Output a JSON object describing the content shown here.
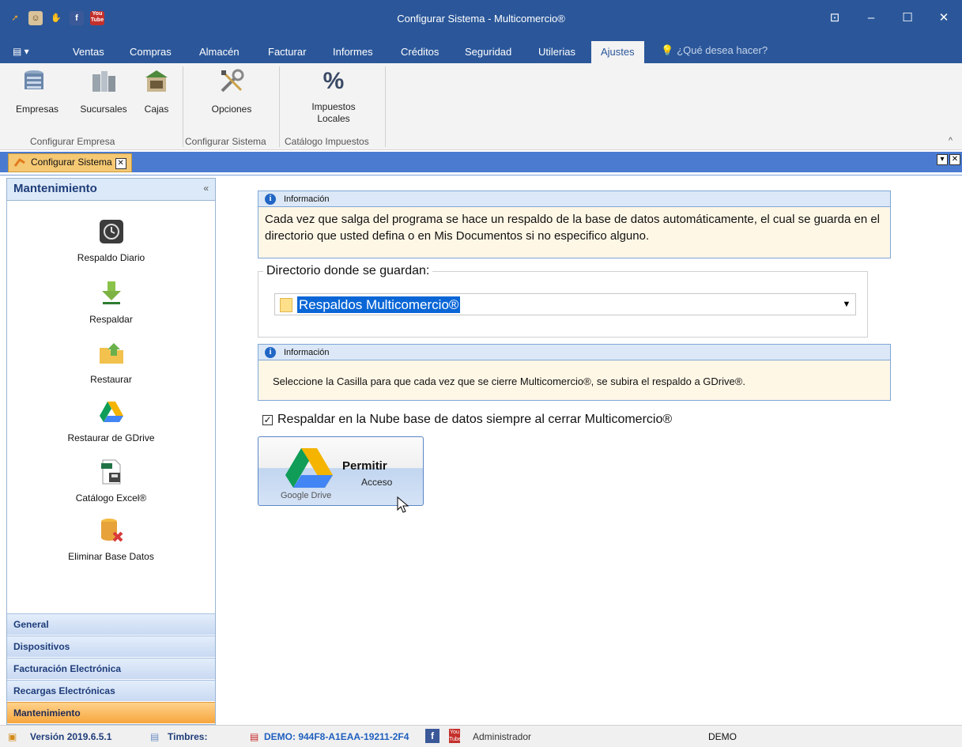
{
  "window": {
    "title": "Configurar Sistema - Multicomercio®",
    "qat_icons": [
      "app-logo-icon",
      "users-icon",
      "hand-icon",
      "facebook-icon",
      "youtube-icon"
    ],
    "youtube_label": "You Tube",
    "facebook_label": "f"
  },
  "menu": {
    "file_icon": "menu-icon",
    "tabs": [
      {
        "label": "Ventas",
        "active": false
      },
      {
        "label": "Compras",
        "active": false
      },
      {
        "label": "Almacén",
        "active": false
      },
      {
        "label": "Facturar",
        "active": false
      },
      {
        "label": "Informes",
        "active": false
      },
      {
        "label": "Créditos",
        "active": false
      },
      {
        "label": "Seguridad",
        "active": false
      },
      {
        "label": "Utilerias",
        "active": false
      },
      {
        "label": "Ajustes",
        "active": true
      }
    ],
    "tellme": "¿Qué desea hacer?"
  },
  "ribbon": {
    "buttons": [
      {
        "label": "Empresas",
        "icon": "building-icon"
      },
      {
        "label": "Sucursales",
        "icon": "branches-icon"
      },
      {
        "label": "Cajas",
        "icon": "store-icon"
      },
      {
        "label": "Opciones",
        "icon": "tools-icon"
      },
      {
        "label": "Impuestos Locales",
        "icon": "percent-icon"
      }
    ],
    "percent_symbol": "%",
    "groups": [
      "Configurar Empresa",
      "Configurar Sistema",
      "Catálogo Impuestos"
    ]
  },
  "doc_tab": {
    "label": "Configurar Sistema"
  },
  "sidebar": {
    "title": "Mantenimiento",
    "items": [
      {
        "label": "Respaldo Diario",
        "icon": "clock-icon"
      },
      {
        "label": "Respaldar",
        "icon": "download-arrow-icon"
      },
      {
        "label": "Restaurar",
        "icon": "folder-up-icon"
      },
      {
        "label": "Restaurar de GDrive",
        "icon": "google-drive-icon"
      },
      {
        "label": "Catálogo Excel®",
        "icon": "excel-file-icon"
      },
      {
        "label": "Eliminar Base Datos",
        "icon": "database-delete-icon"
      }
    ],
    "categories": [
      {
        "label": "General",
        "active": false
      },
      {
        "label": "Dispositivos",
        "active": false
      },
      {
        "label": "Facturación Electrónica",
        "active": false
      },
      {
        "label": "Recargas Electrónicas",
        "active": false
      },
      {
        "label": "Mantenimiento",
        "active": true
      }
    ]
  },
  "main": {
    "info1": {
      "title": "Información",
      "text": "Cada vez que salga del programa se hace un respaldo de la base de datos automáticamente, el cual se guarda en el directorio que usted defina o en Mis Documentos si no especifico alguno."
    },
    "directory": {
      "legend": "Directorio donde se guardan:",
      "value": "Respaldos Multicomercio®"
    },
    "info2": {
      "title": "Información",
      "text": "Seleccione la Casilla para que cada vez que se cierre Multicomercio®, se subira el respaldo a GDrive®."
    },
    "checkbox": {
      "label": "Respaldar en la Nube base de datos siempre al cerrar Multicomercio®",
      "checked": true
    },
    "gdrive_button": {
      "title": "Permitir",
      "subtitle": "Acceso",
      "brand": "Google Drive"
    }
  },
  "status": {
    "version": "Versión 2019.6.5.1",
    "timbres": "Timbres:",
    "demo_key": "DEMO: 944F8-A1EAA-19211-2F4",
    "user": "Administrador",
    "mode": "DEMO"
  }
}
